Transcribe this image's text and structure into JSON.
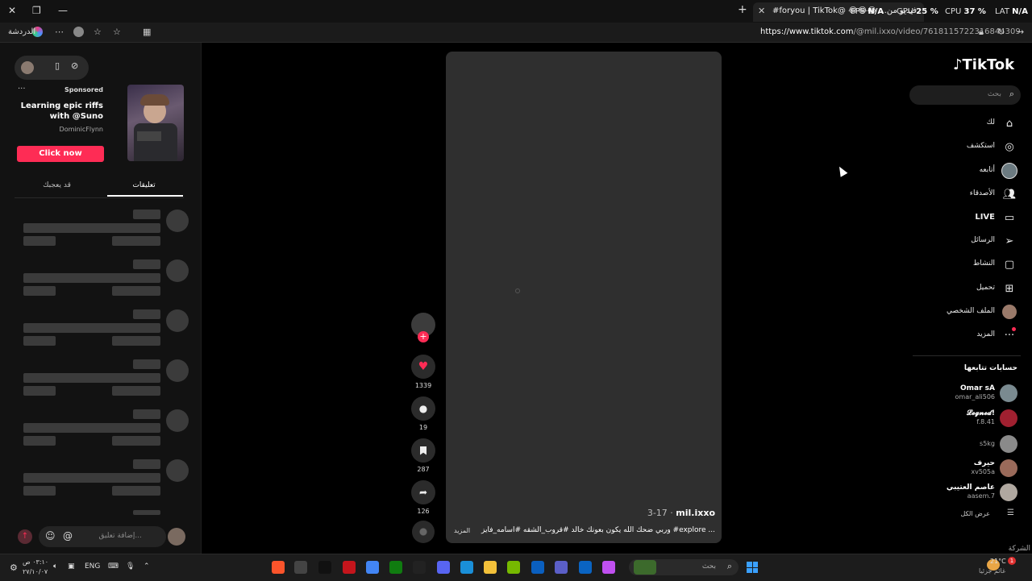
{
  "browser": {
    "tab_title": "#foryou | TikTok@ 😂😂😂 ...فيديو من",
    "url_host": "https://www.tiktok.com",
    "url_path": "/@mil.ixxo/video/7618115722316844309",
    "copilot_label": "الدردشة",
    "hud": {
      "fps_label": "FPS",
      "fps_value": "N/A",
      "gpu_label": "GPU",
      "gpu_value": "25 %",
      "cpu_label": "CPU",
      "cpu_value": "37 %",
      "lat_label": "LAT",
      "lat_value": "N/A"
    }
  },
  "ad": {
    "sponsored": "Sponsored",
    "headline": "Learning epic riffs with @Suno",
    "author": "DominicFlynn",
    "cta": "Click now"
  },
  "comments_tabs": {
    "comments": "تعليقات",
    "may_like": "قد يعجبك"
  },
  "comment_input": {
    "placeholder": "إضافة تعليق...",
    "at": "@"
  },
  "video": {
    "username": "mil.ixxo",
    "date": "3-17",
    "separator": " · ",
    "caption": "وربي ضحك الله يكون بعونك خالد #قروب_الشقه #اسامه_فايز #explore ...",
    "more": "المزيد"
  },
  "actions": {
    "likes": "1339",
    "comments": "19",
    "saves": "287",
    "shares": "126"
  },
  "nav": {
    "logo": "TikTok",
    "search_placeholder": "بحث",
    "items": [
      {
        "label": "لك",
        "icon": "home-icon"
      },
      {
        "label": "استكشف",
        "icon": "compass-icon"
      },
      {
        "label": "أتابعه",
        "icon": "following-avatar-icon"
      },
      {
        "label": "الأصدقاء",
        "icon": "friends-icon"
      },
      {
        "label": "LIVE",
        "icon": "live-icon"
      },
      {
        "label": "الرسائل",
        "icon": "send-icon"
      },
      {
        "label": "النشاط",
        "icon": "activity-icon"
      },
      {
        "label": "تحميل",
        "icon": "upload-icon"
      },
      {
        "label": "الملف الشخصي",
        "icon": "profile-avatar-icon"
      },
      {
        "label": "المزيد",
        "icon": "more-icon"
      }
    ]
  },
  "following": {
    "title": "حسابات تتابعها",
    "accounts": [
      {
        "name": "Omar sA",
        "handle": "omar_ali506"
      },
      {
        "name": "𝓛𝓮𝓰𝓷𝓮𝓭!",
        "handle": "f.8.41"
      },
      {
        "name": "",
        "handle": "s5kg"
      },
      {
        "name": "حيرف",
        "handle": "xv505a"
      },
      {
        "name": "عاصم العتيبي",
        "handle": "aasem.7"
      }
    ],
    "see_all": "عرض الكل"
  },
  "footer": {
    "company": "الشركة"
  },
  "taskbar": {
    "weather_temp": "21°C",
    "weather_desc": "غائم جزئيا",
    "lang": "ENG",
    "time": "٠٣:١٠ ص",
    "date": "٢٧/١٠/٠٧",
    "search_placeholder": "بحث"
  },
  "colors": {
    "accent": "#fe2c55",
    "bg": "#000000",
    "panel": "#121212",
    "video_bg": "#2f2f2f"
  }
}
